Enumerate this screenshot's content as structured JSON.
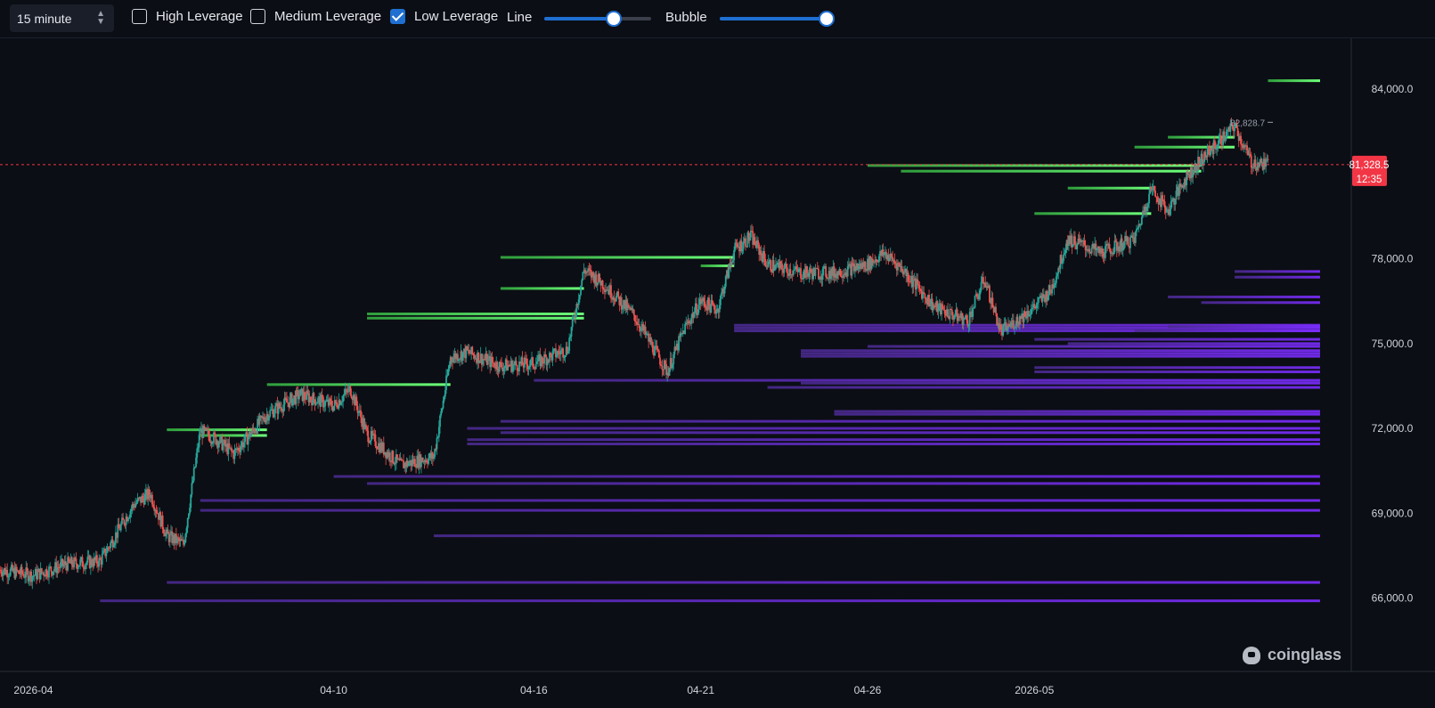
{
  "toolbar": {
    "interval": "15 minute",
    "options": [
      {
        "label": "High Leverage",
        "checked": false
      },
      {
        "label": "Medium Leverage",
        "checked": false
      },
      {
        "label": "Low Leverage",
        "checked": true
      }
    ],
    "line_label": "Line",
    "line_value": 0.65,
    "bubble_label": "Bubble",
    "bubble_value": 1.0
  },
  "brand": "coinglass",
  "colors": {
    "background": "#0b0e14",
    "accent": "#1f6fd1",
    "long_liq": "#5cf06a",
    "short_liq": "#7a2cf5",
    "current_price": "#f23645",
    "candle_up": "#26a69a",
    "candle_down": "#ef5350"
  },
  "chart_data": {
    "type": "line",
    "x_ticks": [
      "2026-04",
      "04-10",
      "04-16",
      "04-21",
      "04-26",
      "2026-05"
    ],
    "y_ticks": [
      "84,000.0",
      "78,000.0",
      "75,000.0",
      "72,000.0",
      "69,000.0",
      "66,000.0"
    ],
    "ylim": [
      63400,
      85800
    ],
    "xlim": [
      "2026-03-31",
      "2026-05-09"
    ],
    "current_price": {
      "value": 81328.5,
      "label": "81,328.5",
      "countdown": "12:35"
    },
    "high_marker": {
      "value": 82828.7,
      "label": "82,828.7",
      "x": "2026-05-07"
    },
    "price_path": [
      [
        "2026-03-31",
        67000
      ],
      [
        "2026-04-01",
        66800
      ],
      [
        "2026-04-02",
        67200
      ],
      [
        "2026-04-03",
        67300
      ],
      [
        "2026-04-04",
        69300
      ],
      [
        "2026-04-04T12",
        69700
      ],
      [
        "2026-04-05",
        68200
      ],
      [
        "2026-04-05T12",
        67900
      ],
      [
        "2026-04-06",
        71900
      ],
      [
        "2026-04-06T12",
        71600
      ],
      [
        "2026-04-07",
        71100
      ],
      [
        "2026-04-08",
        72500
      ],
      [
        "2026-04-09",
        73200
      ],
      [
        "2026-04-10",
        72800
      ],
      [
        "2026-04-10T12",
        73400
      ],
      [
        "2026-04-11",
        71800
      ],
      [
        "2026-04-12",
        70700
      ],
      [
        "2026-04-13",
        71000
      ],
      [
        "2026-04-13T12",
        74500
      ],
      [
        "2026-04-14",
        74700
      ],
      [
        "2026-04-15",
        74200
      ],
      [
        "2026-04-16",
        74300
      ],
      [
        "2026-04-17",
        74800
      ],
      [
        "2026-04-17T12",
        77600
      ],
      [
        "2026-04-18",
        77200
      ],
      [
        "2026-04-19",
        76000
      ],
      [
        "2026-04-20",
        74000
      ],
      [
        "2026-04-20T12",
        75500
      ],
      [
        "2026-04-21",
        76500
      ],
      [
        "2026-04-21T12",
        76200
      ],
      [
        "2026-04-22",
        78300
      ],
      [
        "2026-04-22T12",
        78800
      ],
      [
        "2026-04-23",
        77800
      ],
      [
        "2026-04-24",
        77500
      ],
      [
        "2026-04-25",
        77500
      ],
      [
        "2026-04-26",
        77800
      ],
      [
        "2026-04-26T12",
        78200
      ],
      [
        "2026-04-27",
        77700
      ],
      [
        "2026-04-28",
        76300
      ],
      [
        "2026-04-29",
        75800
      ],
      [
        "2026-04-29T12",
        77300
      ],
      [
        "2026-04-30",
        75400
      ],
      [
        "2026-05-01",
        76300
      ],
      [
        "2026-05-01T12",
        76900
      ],
      [
        "2026-05-02",
        78700
      ],
      [
        "2026-05-03",
        78200
      ],
      [
        "2026-05-04",
        78700
      ],
      [
        "2026-05-04T12",
        80500
      ],
      [
        "2026-05-05",
        79700
      ],
      [
        "2026-05-05T12",
        80800
      ],
      [
        "2026-05-06",
        81500
      ],
      [
        "2026-05-07",
        82700
      ],
      [
        "2026-05-07T12",
        81400
      ],
      [
        "2026-05-08",
        81330
      ]
    ],
    "long_levels": [
      {
        "start": "2026-05-08",
        "price": 84300
      },
      {
        "start": "2026-05-05",
        "price": 82300
      },
      {
        "start": "2026-05-04",
        "price": 81950
      },
      {
        "start": "2026-04-26",
        "price": 81300
      },
      {
        "start": "2026-04-27",
        "price": 81100
      },
      {
        "start": "2026-05-02",
        "price": 80500
      },
      {
        "start": "2026-05-01",
        "price": 79600
      },
      {
        "start": "2026-04-15",
        "price": 78050
      },
      {
        "start": "2026-04-21",
        "price": 77750
      },
      {
        "start": "2026-04-15",
        "price": 76950
      },
      {
        "start": "2026-04-11",
        "price": 76050
      },
      {
        "start": "2026-04-11",
        "price": 75900
      },
      {
        "start": "2026-04-08",
        "price": 73550
      },
      {
        "start": "2026-04-05",
        "price": 71950
      },
      {
        "start": "2026-04-06",
        "price": 71750
      }
    ],
    "short_levels": [
      {
        "start": "2026-05-07",
        "price": 77550
      },
      {
        "start": "2026-05-07",
        "price": 77350
      },
      {
        "start": "2026-05-05",
        "price": 76650
      },
      {
        "start": "2026-05-06",
        "price": 76450
      },
      {
        "start": "2026-04-22",
        "price": 75650
      },
      {
        "start": "2026-04-22",
        "price": 75550
      },
      {
        "start": "2026-04-22",
        "price": 75450
      },
      {
        "start": "2026-05-05",
        "price": 75600
      },
      {
        "start": "2026-05-04",
        "price": 75450
      },
      {
        "start": "2026-05-01",
        "price": 75150
      },
      {
        "start": "2026-05-02",
        "price": 75000
      },
      {
        "start": "2026-04-26",
        "price": 74900
      },
      {
        "start": "2026-04-24",
        "price": 74750
      },
      {
        "start": "2026-04-24",
        "price": 74650
      },
      {
        "start": "2026-04-24",
        "price": 74550
      },
      {
        "start": "2026-05-01",
        "price": 74150
      },
      {
        "start": "2026-05-01",
        "price": 74000
      },
      {
        "start": "2026-04-16",
        "price": 73700
      },
      {
        "start": "2026-04-24",
        "price": 73600
      },
      {
        "start": "2026-04-23",
        "price": 73450
      },
      {
        "start": "2026-04-25",
        "price": 72600
      },
      {
        "start": "2026-04-25",
        "price": 72500
      },
      {
        "start": "2026-04-15",
        "price": 72250
      },
      {
        "start": "2026-04-14",
        "price": 72000
      },
      {
        "start": "2026-04-15",
        "price": 71850
      },
      {
        "start": "2026-04-14",
        "price": 71600
      },
      {
        "start": "2026-04-14",
        "price": 71450
      },
      {
        "start": "2026-04-10",
        "price": 70300
      },
      {
        "start": "2026-04-11",
        "price": 70050
      },
      {
        "start": "2026-04-06",
        "price": 69450
      },
      {
        "start": "2026-04-06",
        "price": 69100
      },
      {
        "start": "2026-04-13",
        "price": 68200
      },
      {
        "start": "2026-04-05",
        "price": 66550
      },
      {
        "start": "2026-04-03",
        "price": 65900
      }
    ]
  }
}
